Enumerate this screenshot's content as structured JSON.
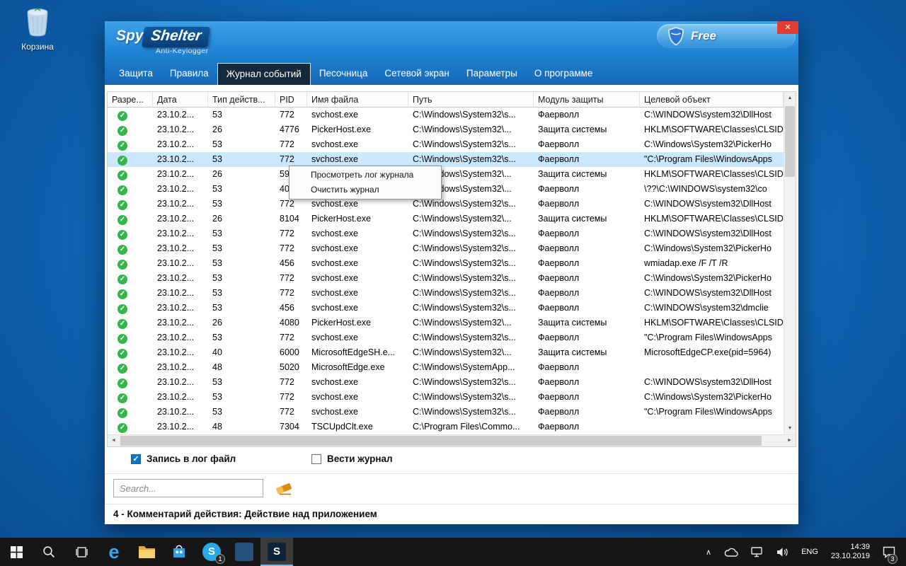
{
  "desktop": {
    "recycle_bin_label": "Корзина"
  },
  "icons": {
    "check": "✓",
    "close": "✕",
    "scroll_up": "▲",
    "scroll_down": "▼",
    "scroll_left": "◄",
    "scroll_right": "►",
    "chevron_up": "∧",
    "edge_e": "e",
    "skype_s": "S",
    "shelter_s": "S"
  },
  "colors": {
    "titlebar_blue": "#1f84d4",
    "active_tab": "#15293c",
    "selected_row": "#cbe8ff",
    "allowed_green": "#33b54a",
    "close_red": "#e23b32"
  },
  "window": {
    "logo": {
      "spy": "Spy",
      "shelter": "Shelter",
      "subtitle": "Anti-Keylogger"
    },
    "license_badge": "Free",
    "tabs": [
      {
        "label": "Защита",
        "active": false
      },
      {
        "label": "Правила",
        "active": false
      },
      {
        "label": "Журнал событий",
        "active": true
      },
      {
        "label": "Песочница",
        "active": false
      },
      {
        "label": "Сетевой экран",
        "active": false
      },
      {
        "label": "Параметры",
        "active": false
      },
      {
        "label": "О программе",
        "active": false
      }
    ],
    "table": {
      "columns": [
        "Разре...",
        "Дата",
        "Тип действ...",
        "PID",
        "Имя файла",
        "Путь",
        "Модуль защиты",
        "Целевой объект"
      ],
      "rows": [
        {
          "selected": false,
          "cells": [
            "23.10.2...",
            "53",
            "772",
            "svchost.exe",
            "C:\\Windows\\System32\\s...",
            "Фаерволл",
            "C:\\WINDOWS\\system32\\DllHost"
          ]
        },
        {
          "selected": false,
          "cells": [
            "23.10.2...",
            "26",
            "4776",
            "PickerHost.exe",
            "C:\\Windows\\System32\\...",
            "Защита системы",
            "HKLM\\SOFTWARE\\Classes\\CLSID"
          ]
        },
        {
          "selected": false,
          "cells": [
            "23.10.2...",
            "53",
            "772",
            "svchost.exe",
            "C:\\Windows\\System32\\s...",
            "Фаерволл",
            "C:\\Windows\\System32\\PickerHo"
          ]
        },
        {
          "selected": true,
          "cells": [
            "23.10.2...",
            "53",
            "772",
            "svchost.exe",
            "C:\\Windows\\System32\\s...",
            "Фаерволл",
            "\"C:\\Program Files\\WindowsApps"
          ]
        },
        {
          "selected": false,
          "cells": [
            "23.10.2...",
            "26",
            "594",
            "",
            "C:\\Windows\\System32\\...",
            "Защита системы",
            "HKLM\\SOFTWARE\\Classes\\CLSID"
          ]
        },
        {
          "selected": false,
          "cells": [
            "23.10.2...",
            "53",
            "405",
            "",
            "C:\\Windows\\System32\\...",
            "Фаерволл",
            "\\??\\C:\\WINDOWS\\system32\\co"
          ]
        },
        {
          "selected": false,
          "cells": [
            "23.10.2...",
            "53",
            "772",
            "svchost.exe",
            "C:\\Windows\\System32\\s...",
            "Фаерволл",
            "C:\\WINDOWS\\system32\\DllHost"
          ]
        },
        {
          "selected": false,
          "cells": [
            "23.10.2...",
            "26",
            "8104",
            "PickerHost.exe",
            "C:\\Windows\\System32\\...",
            "Защита системы",
            "HKLM\\SOFTWARE\\Classes\\CLSID"
          ]
        },
        {
          "selected": false,
          "cells": [
            "23.10.2...",
            "53",
            "772",
            "svchost.exe",
            "C:\\Windows\\System32\\s...",
            "Фаерволл",
            "C:\\WINDOWS\\system32\\DllHost"
          ]
        },
        {
          "selected": false,
          "cells": [
            "23.10.2...",
            "53",
            "772",
            "svchost.exe",
            "C:\\Windows\\System32\\s...",
            "Фаерволл",
            "C:\\Windows\\System32\\PickerHo"
          ]
        },
        {
          "selected": false,
          "cells": [
            "23.10.2...",
            "53",
            "456",
            "svchost.exe",
            "C:\\Windows\\System32\\s...",
            "Фаерволл",
            "wmiadap.exe /F /T /R"
          ]
        },
        {
          "selected": false,
          "cells": [
            "23.10.2...",
            "53",
            "772",
            "svchost.exe",
            "C:\\Windows\\System32\\s...",
            "Фаерволл",
            "C:\\Windows\\System32\\PickerHo"
          ]
        },
        {
          "selected": false,
          "cells": [
            "23.10.2...",
            "53",
            "772",
            "svchost.exe",
            "C:\\Windows\\System32\\s...",
            "Фаерволл",
            "C:\\WINDOWS\\system32\\DllHost"
          ]
        },
        {
          "selected": false,
          "cells": [
            "23.10.2...",
            "53",
            "456",
            "svchost.exe",
            "C:\\Windows\\System32\\s...",
            "Фаерволл",
            "C:\\WINDOWS\\system32\\dmclie"
          ]
        },
        {
          "selected": false,
          "cells": [
            "23.10.2...",
            "26",
            "4080",
            "PickerHost.exe",
            "C:\\Windows\\System32\\...",
            "Защита системы",
            "HKLM\\SOFTWARE\\Classes\\CLSID"
          ]
        },
        {
          "selected": false,
          "cells": [
            "23.10.2...",
            "53",
            "772",
            "svchost.exe",
            "C:\\Windows\\System32\\s...",
            "Фаерволл",
            "\"C:\\Program Files\\WindowsApps"
          ]
        },
        {
          "selected": false,
          "cells": [
            "23.10.2...",
            "40",
            "6000",
            "MicrosoftEdgeSH.e...",
            "C:\\Windows\\System32\\...",
            "Защита системы",
            "MicrosoftEdgeCP.exe(pid=5964)"
          ]
        },
        {
          "selected": false,
          "cells": [
            "23.10.2...",
            "48",
            "5020",
            "MicrosoftEdge.exe",
            "C:\\Windows\\SystemApp...",
            "Фаерволл",
            ""
          ]
        },
        {
          "selected": false,
          "cells": [
            "23.10.2...",
            "53",
            "772",
            "svchost.exe",
            "C:\\Windows\\System32\\s...",
            "Фаерволл",
            "C:\\WINDOWS\\system32\\DllHost"
          ]
        },
        {
          "selected": false,
          "cells": [
            "23.10.2...",
            "53",
            "772",
            "svchost.exe",
            "C:\\Windows\\System32\\s...",
            "Фаерволл",
            "C:\\Windows\\System32\\PickerHo"
          ]
        },
        {
          "selected": false,
          "cells": [
            "23.10.2...",
            "53",
            "772",
            "svchost.exe",
            "C:\\Windows\\System32\\s...",
            "Фаерволл",
            "\"C:\\Program Files\\WindowsApps"
          ]
        },
        {
          "selected": false,
          "cells": [
            "23.10.2...",
            "48",
            "7304",
            "TSCUpdClt.exe",
            "C:\\Program Files\\Commo...",
            "Фаерволл",
            ""
          ]
        }
      ]
    },
    "context_menu": {
      "items": [
        "Просмотреть лог журнала",
        "Очистить журнал"
      ]
    },
    "options": [
      {
        "label": "Запись в лог файл",
        "checked": true
      },
      {
        "label": "Вести журнал",
        "checked": false
      }
    ],
    "search_placeholder": "Search...",
    "status_text": "4 - Комментарий действия: Действие над приложением"
  },
  "taskbar": {
    "language": "ENG",
    "time": "14:39",
    "date": "23.10.2019",
    "skype_badge": "1",
    "notification_badge": "3"
  }
}
